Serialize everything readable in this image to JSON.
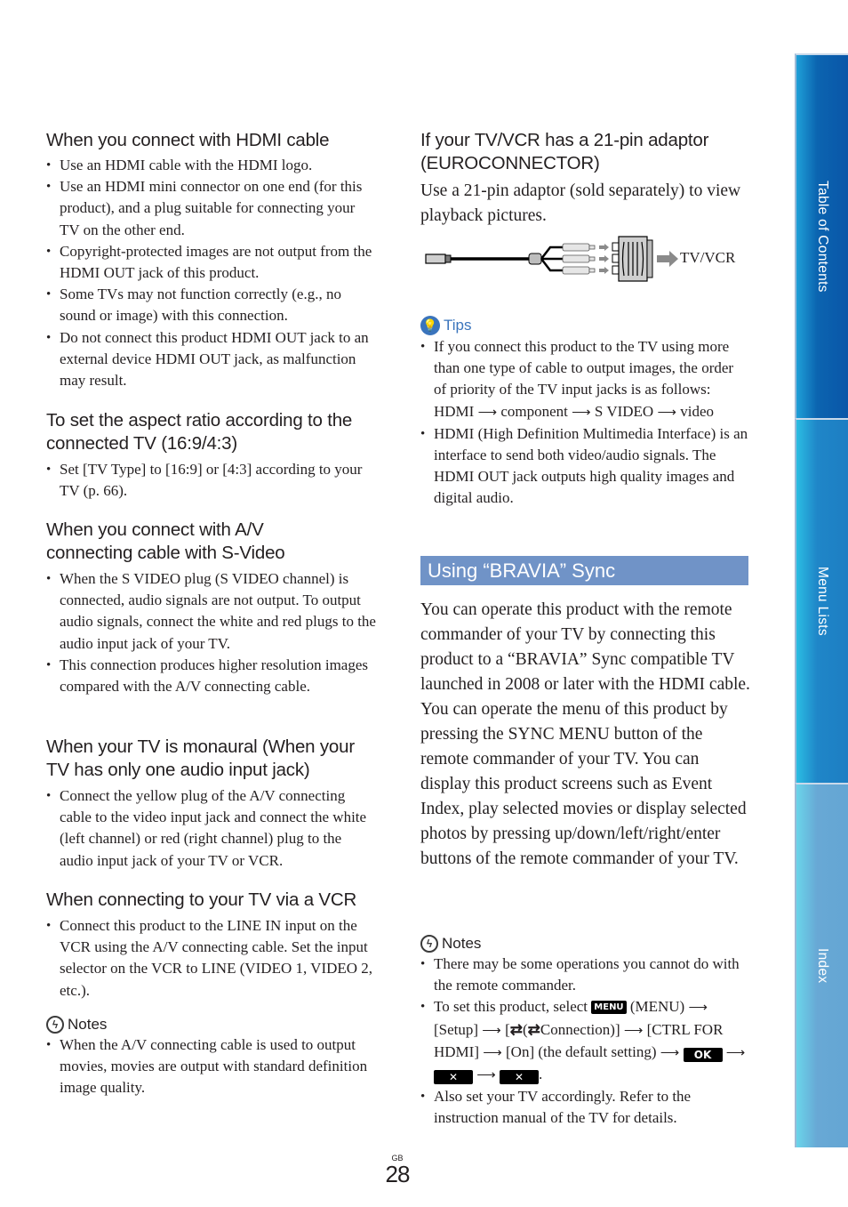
{
  "left_column": {
    "sections": [
      {
        "heading": "When you connect with HDMI cable",
        "bullets": [
          "Use an HDMI cable with the HDMI logo.",
          "Use an HDMI mini connector on one end (for this product), and a plug suitable for connecting your TV on the other end.",
          "Copyright-protected images are not output from the HDMI OUT jack of this product.",
          "Some TVs may not function correctly (e.g., no sound or image) with this connection.",
          "Do not connect this product HDMI OUT jack to an external device HDMI OUT jack, as malfunction may result."
        ]
      },
      {
        "heading": "To set the aspect ratio according to the connected TV (16:9/4:3)",
        "bullets": [
          "Set [TV Type] to [16:9] or [4:3] according to your TV (p. 66)."
        ]
      },
      {
        "heading": "When you connect with A/V connecting cable with S-Video",
        "bullets": [
          "When the S VIDEO plug (S VIDEO channel) is connected, audio signals are not output. To output audio signals, connect the white and red plugs to the audio input jack of your TV.",
          "This connection produces higher resolution images compared with the A/V connecting cable."
        ]
      },
      {
        "heading": "When your TV is monaural (When your TV has only one audio input jack)",
        "bullets": [
          "Connect the yellow plug of the A/V connecting cable to the video input jack and connect the white (left channel) or red (right channel) plug to the audio input jack of your TV or VCR."
        ]
      },
      {
        "heading": "When connecting to your TV via a VCR",
        "bullets": [
          "Connect this product to the LINE IN input on the VCR using the A/V connecting cable. Set the input selector on the VCR to LINE (VIDEO 1, VIDEO 2, etc.)."
        ]
      }
    ],
    "notes": {
      "label": "Notes",
      "icon": "notes-lightning-icon",
      "bullets": [
        "When the A/V connecting cable is used to output movies, movies are output with standard definition image quality."
      ]
    }
  },
  "right_column": {
    "euro": {
      "heading": "If your TV/VCR has a 21-pin adaptor (EUROCONNECTOR)",
      "body": "Use a 21-pin adaptor (sold separately) to view playback pictures.",
      "diagram_label": "TV/VCR"
    },
    "tips": {
      "label": "Tips",
      "icon": "tips-lightbulb-icon",
      "bullet1": "If you connect this product to the TV using more than one type of cable to output images, the order of priority of the TV input jacks is as follows:",
      "priority": [
        "HDMI",
        "component",
        "S VIDEO",
        "video"
      ],
      "bullet2": "HDMI (High Definition Multimedia Interface) is an interface to send both video/audio signals. The HDMI OUT jack outputs high quality images and digital audio."
    },
    "bravia": {
      "title": "Using “BRAVIA” Sync",
      "para1": "You can operate this product with the remote commander of your TV by connecting this product to a “BRAVIA” Sync compatible TV launched in 2008 or later with the HDMI cable.",
      "para2": "You can operate the menu of this product by pressing the SYNC MENU button of the remote commander of your TV. You can display this product screens such as Event Index, play selected movies or display selected photos by pressing up/down/left/right/enter buttons of the remote commander of your TV."
    },
    "notes": {
      "label": "Notes",
      "bullet1": "There may be some operations you cannot do with the remote commander.",
      "bullet2": {
        "t1": "To set this product, select",
        "menu_key": "MENU",
        "t2": "(MENU)",
        "t3": "[Setup]",
        "t4": "[",
        "t5": "(",
        "t6": "Connection)]",
        "t7": "[CTRL FOR HDMI]",
        "t8": "[On] (the default setting)",
        "ok_key": "OK",
        "close_key": "✕",
        "end": "."
      },
      "bullet3": "Also set your TV accordingly. Refer to the instruction manual of the TV for details."
    }
  },
  "arrow_glyph": "⟶",
  "sidebar": {
    "tabs": [
      {
        "label": "Table of Contents"
      },
      {
        "label": "Menu Lists"
      },
      {
        "label": "Index"
      }
    ]
  },
  "footer": {
    "region": "GB",
    "page_number": "28"
  }
}
